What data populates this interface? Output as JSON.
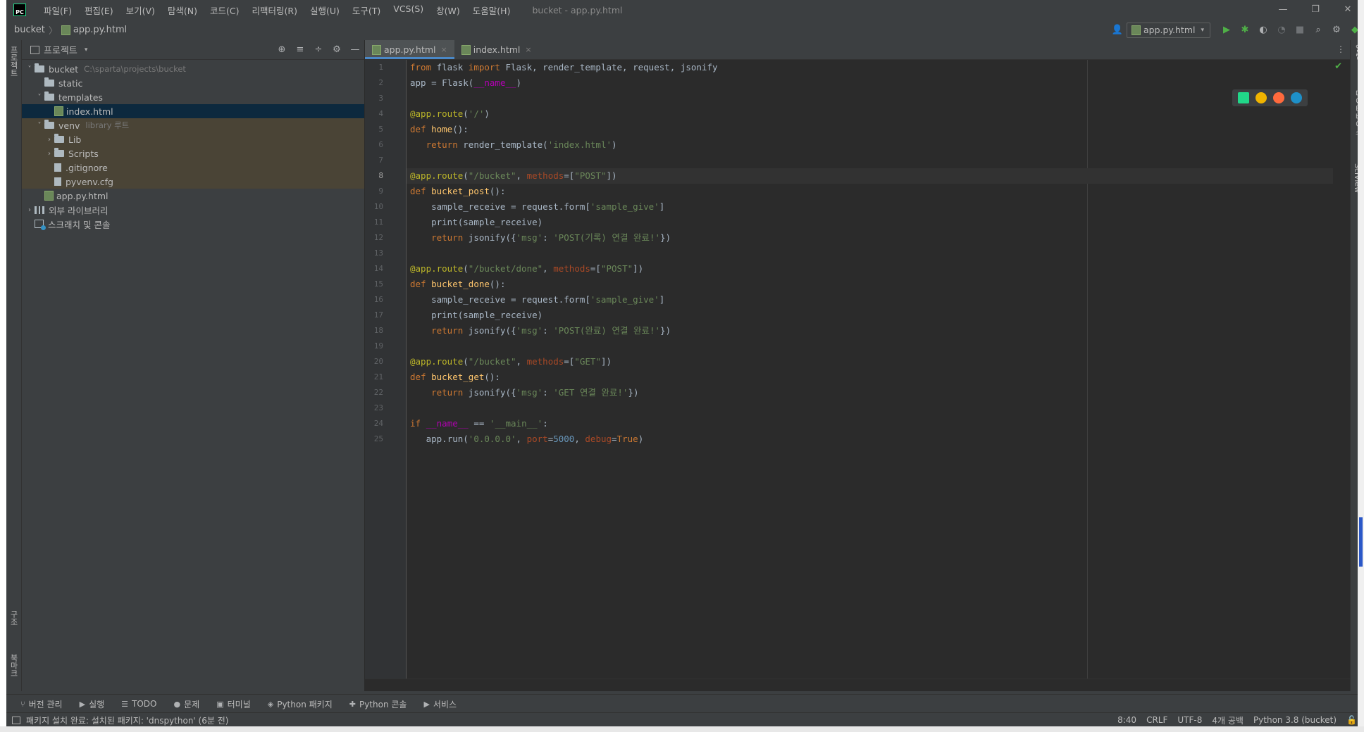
{
  "window": {
    "title": "bucket - app.py.html",
    "logo": "PC",
    "controls": [
      "—",
      "❐",
      "✕"
    ]
  },
  "menu": [
    "파일(F)",
    "편집(E)",
    "보기(V)",
    "탐색(N)",
    "코드(C)",
    "리팩터링(R)",
    "실행(U)",
    "도구(T)",
    "VCS(S)",
    "창(W)",
    "도움말(H)"
  ],
  "breadcrumb": {
    "project": "bucket",
    "separator": "〉",
    "file": "app.py.html"
  },
  "run_config": {
    "label": "app.py.html",
    "caret": "▾"
  },
  "left_stripe": {
    "top_tab": "프로젝트",
    "structure_tab": "구조",
    "bookmarks_tab": "북마크"
  },
  "right_stripe": {
    "notifications_tab": "알림",
    "database_tab": "데이터베이스",
    "sciview_tab": "SciView"
  },
  "project_panel": {
    "title": "프로젝트",
    "caret": "▾",
    "tools": [
      "⊕",
      "≡",
      "÷",
      "⚙",
      "—"
    ],
    "tree": [
      {
        "label": "bucket",
        "path": "C:\\sparta\\projects\\bucket",
        "arrow": "˅",
        "type": "folder",
        "indent": 0,
        "state": "normal"
      },
      {
        "label": "static",
        "arrow": "",
        "type": "folder",
        "indent": 1,
        "state": "normal"
      },
      {
        "label": "templates",
        "arrow": "˅",
        "type": "folder",
        "indent": 1,
        "state": "normal"
      },
      {
        "label": "index.html",
        "arrow": "",
        "type": "html",
        "indent": 2,
        "state": "selected"
      },
      {
        "label": "venv",
        "path": "library 루트",
        "arrow": "˅",
        "type": "folder",
        "indent": 1,
        "state": "excluded"
      },
      {
        "label": "Lib",
        "arrow": "›",
        "type": "folder",
        "indent": 2,
        "state": "excluded"
      },
      {
        "label": "Scripts",
        "arrow": "›",
        "type": "folder",
        "indent": 2,
        "state": "excluded"
      },
      {
        "label": ".gitignore",
        "arrow": "",
        "type": "file",
        "indent": 2,
        "state": "excluded"
      },
      {
        "label": "pyvenv.cfg",
        "arrow": "",
        "type": "file",
        "indent": 2,
        "state": "excluded"
      },
      {
        "label": "app.py.html",
        "arrow": "",
        "type": "html",
        "indent": 1,
        "state": "normal"
      },
      {
        "label": "외부 라이브러리",
        "arrow": "›",
        "type": "library",
        "indent": 0,
        "state": "normal"
      },
      {
        "label": "스크래치 및 콘솔",
        "arrow": "",
        "type": "scratch",
        "indent": 0,
        "state": "normal"
      }
    ]
  },
  "editor": {
    "tabs": [
      {
        "label": "app.py.html",
        "active": true,
        "close": "×"
      },
      {
        "label": "index.html",
        "active": false,
        "close": "×"
      }
    ],
    "more": "⋮",
    "inspection_ok": "✔",
    "current_line": 8,
    "lines": [
      "from flask import Flask, render_template, request, jsonify",
      "app = Flask(__name__)",
      "",
      "@app.route('/')",
      "def home():",
      "   return render_template('index.html')",
      "",
      "@app.route(\"/bucket\", methods=[\"POST\"])",
      "def bucket_post():",
      "    sample_receive = request.form['sample_give']",
      "    print(sample_receive)",
      "    return jsonify({'msg': 'POST(기록) 연결 완료!'})",
      "",
      "@app.route(\"/bucket/done\", methods=[\"POST\"])",
      "def bucket_done():",
      "    sample_receive = request.form['sample_give']",
      "    print(sample_receive)",
      "    return jsonify({'msg': 'POST(완료) 연결 완료!'})",
      "",
      "@app.route(\"/bucket\", methods=[\"GET\"])",
      "def bucket_get():",
      "    return jsonify({'msg': 'GET 연결 완료!'})",
      "",
      "if __name__ == '__main__':",
      "   app.run('0.0.0.0', port=5000, debug=True)"
    ],
    "browser_colors": [
      "#21d789",
      "#f0b400",
      "#ff6a3d",
      "#1e90c8"
    ]
  },
  "colors": {
    "keyword": "#cc7832",
    "string": "#6a8759",
    "decorator": "#bbb529",
    "function": "#ffc66d",
    "number": "#6897bb",
    "dunder": "#b200b2",
    "param": "#aa4926",
    "text": "#a9b7c6"
  },
  "bottom_toolbar": [
    {
      "icon": "⑂",
      "label": "버전 관리"
    },
    {
      "icon": "▶",
      "label": "실행"
    },
    {
      "icon": "☰",
      "label": "TODO"
    },
    {
      "icon": "●",
      "label": "문제"
    },
    {
      "icon": "▣",
      "label": "터미널"
    },
    {
      "icon": "◈",
      "label": "Python 패키지"
    },
    {
      "icon": "✚",
      "label": "Python 콘솔"
    },
    {
      "icon": "▶",
      "label": "서비스"
    }
  ],
  "status_bar": {
    "message": "패키지 설치 완료: 설치된 패키지: 'dnspython' (6분 전)",
    "position": "8:40",
    "line_separator": "CRLF",
    "encoding": "UTF-8",
    "indent": "4개 공백",
    "interpreter": "Python 3.8 (bucket)",
    "lock": "🔓"
  }
}
